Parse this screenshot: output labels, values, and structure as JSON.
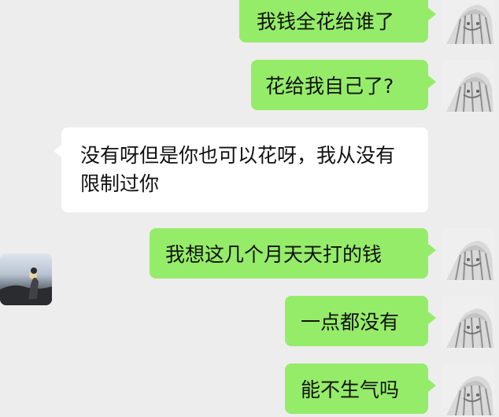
{
  "chat": {
    "messages": [
      {
        "sender": "self",
        "text": "我钱全花给谁了"
      },
      {
        "sender": "self",
        "text": "花给我自己了?"
      },
      {
        "sender": "contact",
        "text": "没有呀但是你也可以花呀，我从没有限制过你"
      },
      {
        "sender": "self",
        "text": "我想这几个月天天打的钱"
      },
      {
        "sender": "self",
        "text": "一点都没有"
      },
      {
        "sender": "self",
        "text": "能不生气吗"
      }
    ]
  },
  "icons": {
    "self_avatar": "anime-avatar-icon",
    "contact_avatar": "sunset-photo-avatar-icon"
  },
  "colors": {
    "background": "#ededed",
    "self_bubble": "#95ec69",
    "contact_bubble": "#ffffff",
    "text": "#111111"
  }
}
